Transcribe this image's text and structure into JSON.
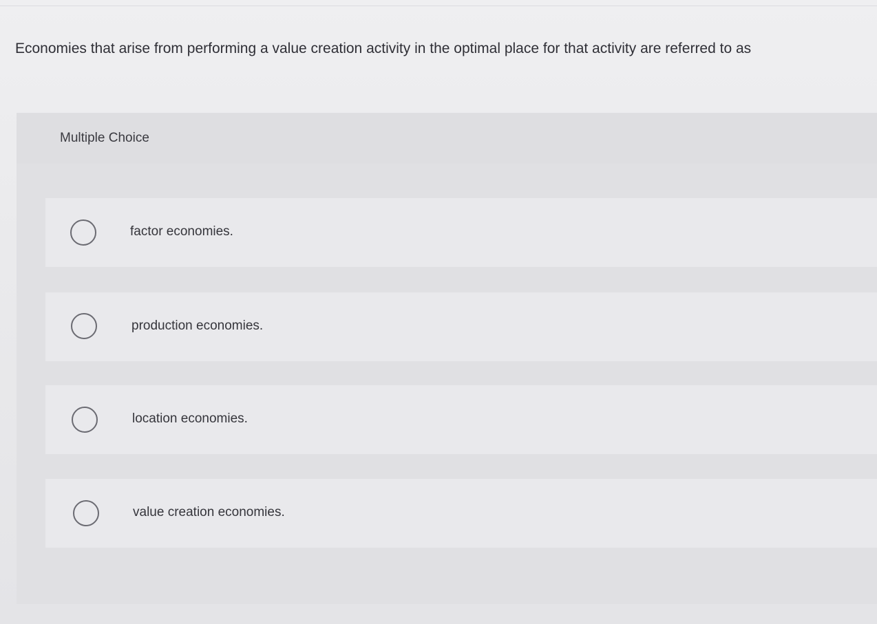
{
  "question": {
    "text": "Economies that arise from performing a value creation activity in the optimal place for that activity are referred to as"
  },
  "multiple_choice": {
    "title": "Multiple Choice",
    "options": [
      {
        "label": "factor economies.",
        "selected": false
      },
      {
        "label": "production economies.",
        "selected": false
      },
      {
        "label": "location economies.",
        "selected": false
      },
      {
        "label": "value creation economies.",
        "selected": false
      }
    ]
  },
  "colors": {
    "background": "#ebebed",
    "panel": "#e0e0e3",
    "option_row": "#e9e9ec",
    "radio_border": "#6b6b72",
    "text": "#2f2f36"
  }
}
